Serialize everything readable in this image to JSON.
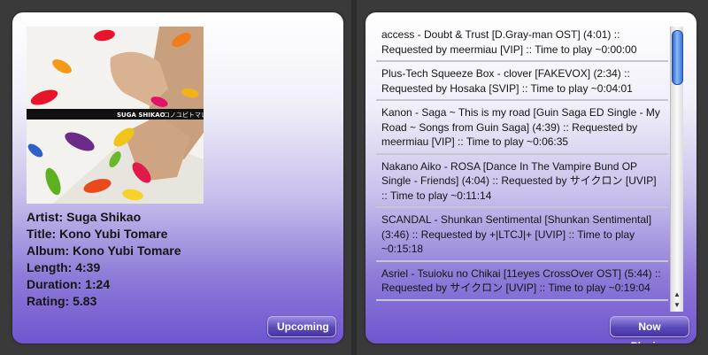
{
  "now_playing": {
    "artist": "Artist: Suga Shikao",
    "title": "Title: Kono Yubi Tomare",
    "album": "Album: Kono Yubi Tomare",
    "length": "Length: 4:39",
    "duration": "Duration: 1:24",
    "rating": "Rating: 5.83",
    "cover_label_artist": "SUGA SHIKAO",
    "cover_label_title": "コノユビトマレ",
    "upcoming_label": "Upcoming"
  },
  "queue": {
    "now_playing_label": "Now Playing",
    "items": [
      "access - Doubt & Trust [D.Gray-man OST] (4:01) :: Requested by meermiau [VIP] :: Time to play ~0:00:00",
      "Plus-Tech Squeeze Box - clover [FAKEVOX] (2:34) :: Requested by Hosaka [SVIP] :: Time to play ~0:04:01",
      "Kanon - Saga ~ This is my road [Guin Saga ED Single - My Road ~ Songs from Guin Saga] (4:39) :: Requested by meermiau [VIP] :: Time to play ~0:06:35",
      "Nakano Aiko - ROSA [Dance In The Vampire Bund OP Single - Friends] (4:04) :: Requested by サイクロン [UVIP] :: Time to play ~0:11:14",
      "SCANDAL - Shunkan Sentimental [Shunkan Sentimental] (3:46) :: Requested by +|LTCJ|+ [UVIP] :: Time to play ~0:15:18",
      "Asriel - Tsuioku no Chikai [11eyes CrossOver OST] (5:44) :: Requested by サイクロン [UVIP] :: Time to play ~0:19:04"
    ]
  }
}
